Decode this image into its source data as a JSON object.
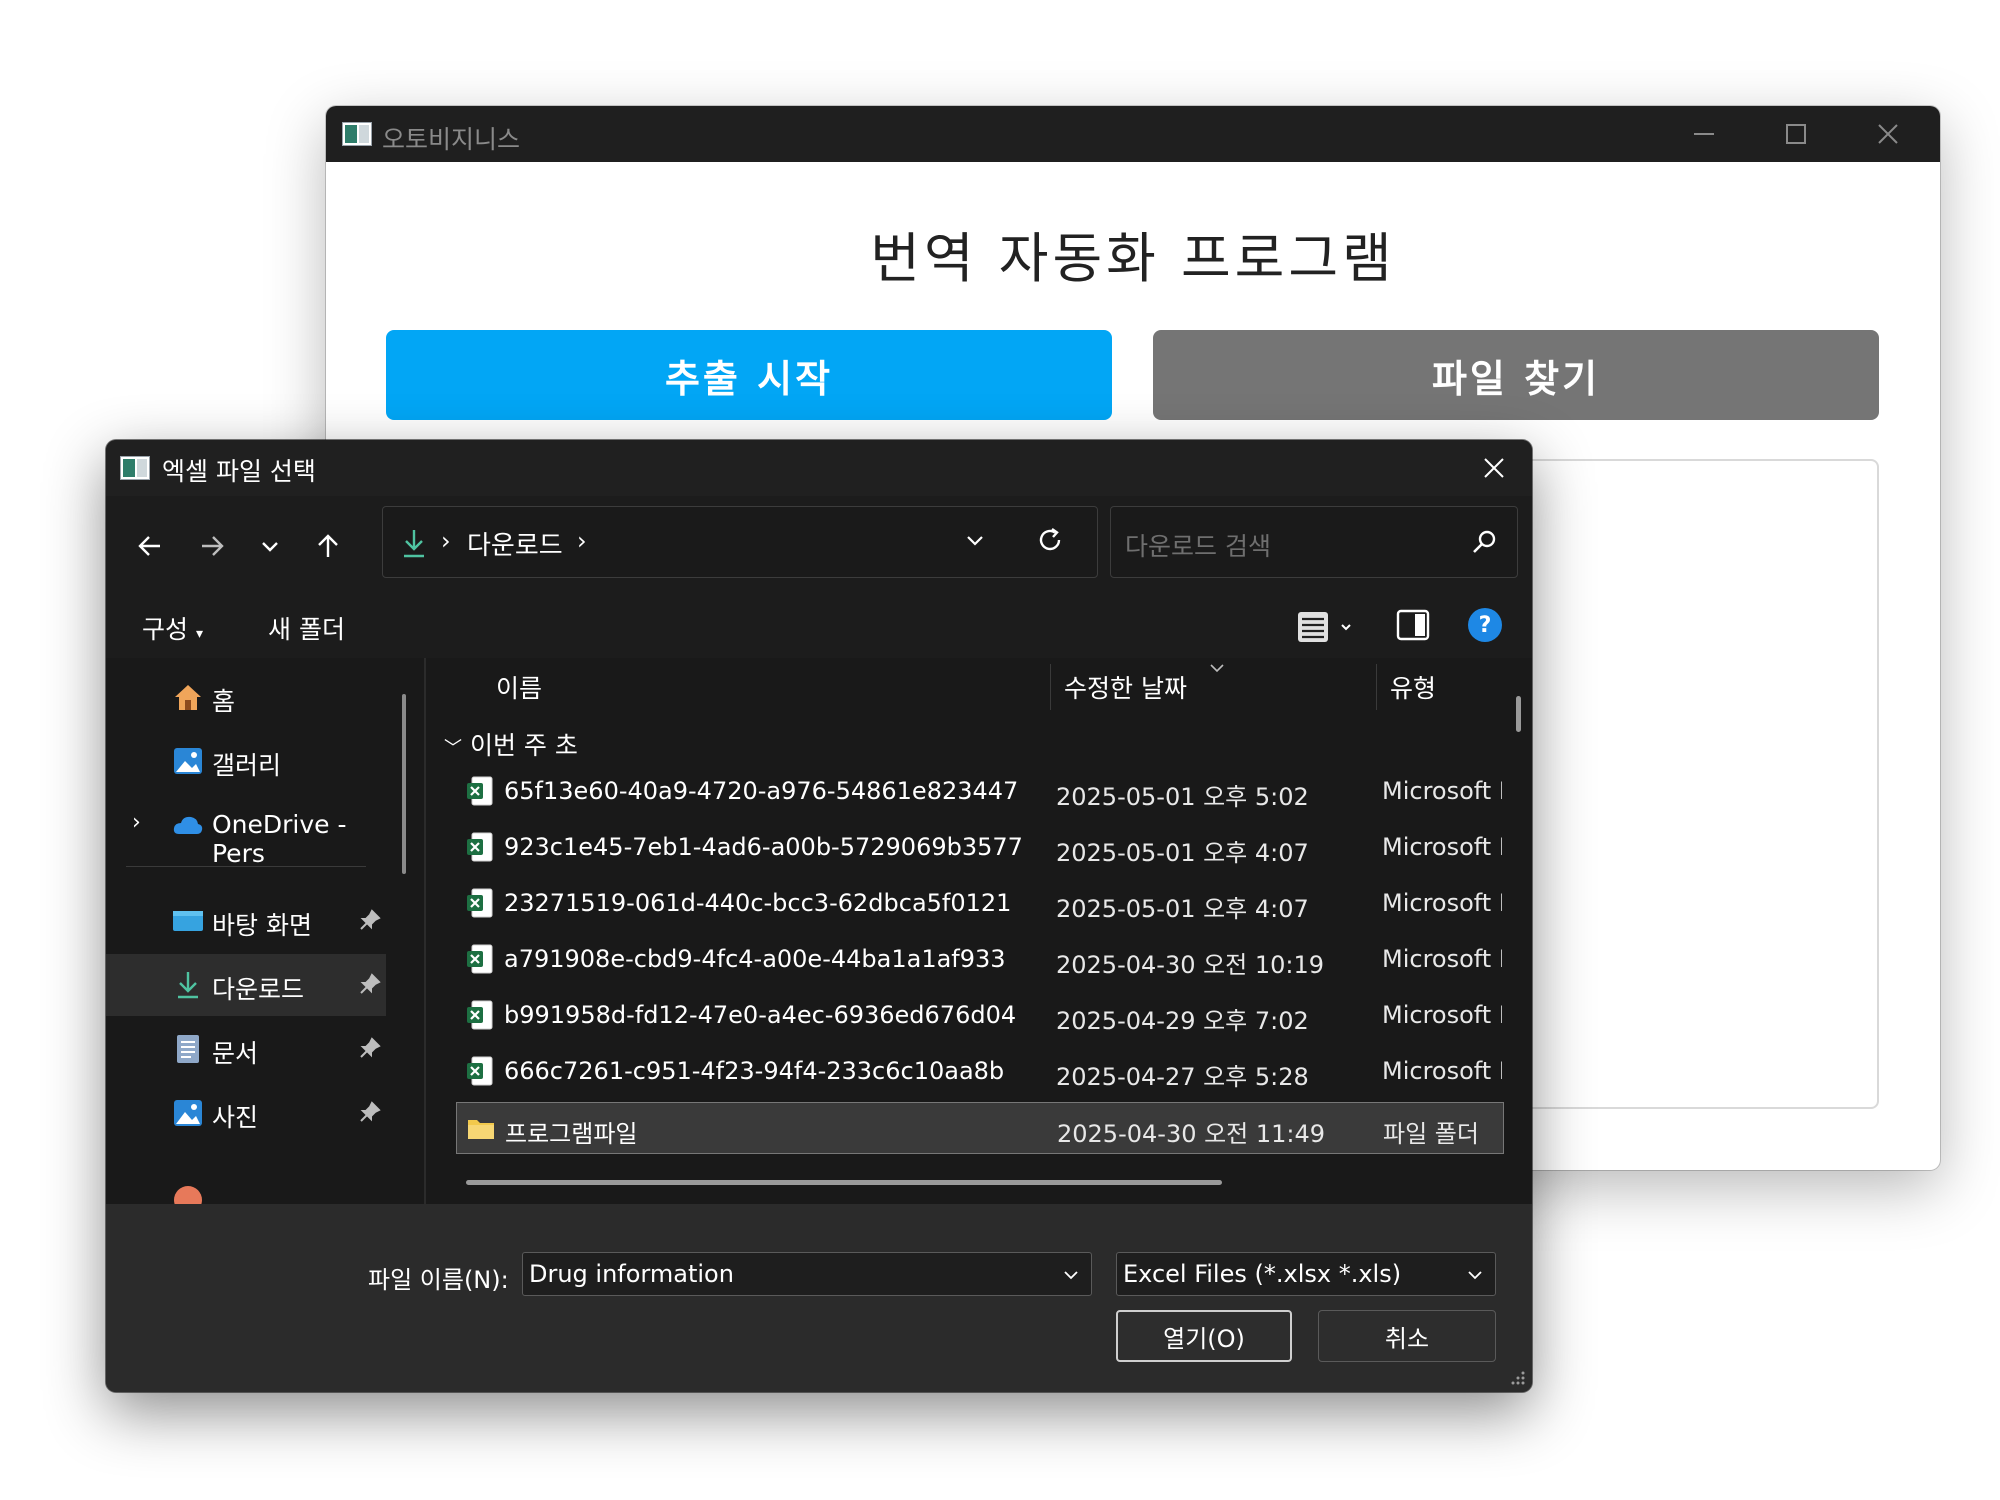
{
  "main_window": {
    "title": "오토비지니스",
    "heading": "번역 자동화 프로그램",
    "extract_button": "추출 시작",
    "find_button": "파일 찾기"
  },
  "dialog": {
    "title": "엑셀 파일 선택",
    "address": {
      "location": "다운로드"
    },
    "search": {
      "placeholder": "다운로드 검색"
    },
    "toolbar": {
      "organize": "구성",
      "new_folder": "새 폴더"
    },
    "sidebar": {
      "items": [
        {
          "label": "홈",
          "icon": "home-icon"
        },
        {
          "label": "갤러리",
          "icon": "gallery-icon"
        },
        {
          "label": "OneDrive - Pers",
          "icon": "onedrive-icon"
        },
        {
          "label": "바탕 화면",
          "icon": "desktop-icon"
        },
        {
          "label": "다운로드",
          "icon": "download-icon"
        },
        {
          "label": "문서",
          "icon": "documents-icon"
        },
        {
          "label": "사진",
          "icon": "pictures-icon"
        }
      ]
    },
    "columns": {
      "name": "이름",
      "modified": "수정한 날짜",
      "type": "유형"
    },
    "group": "이번 주 초",
    "files": [
      {
        "name": "65f13e60-40a9-4720-a976-54861e823447",
        "date": "2025-05-01 오후 5:02",
        "type": "Microsoft E"
      },
      {
        "name": "923c1e45-7eb1-4ad6-a00b-5729069b3577",
        "date": "2025-05-01 오후 4:07",
        "type": "Microsoft E"
      },
      {
        "name": "23271519-061d-440c-bcc3-62dbca5f0121",
        "date": "2025-05-01 오후 4:07",
        "type": "Microsoft E"
      },
      {
        "name": "a791908e-cbd9-4fc4-a00e-44ba1a1af933",
        "date": "2025-04-30 오전 10:19",
        "type": "Microsoft E"
      },
      {
        "name": "b991958d-fd12-47e0-a4ec-6936ed676d04",
        "date": "2025-04-29 오후 7:02",
        "type": "Microsoft E"
      },
      {
        "name": "666c7261-c951-4f23-94f4-233c6c10aa8b",
        "date": "2025-04-27 오후 5:28",
        "type": "Microsoft E"
      },
      {
        "name": "프로그램파일",
        "date": "2025-04-30 오전 11:49",
        "type": "파일 폴더"
      }
    ],
    "filename_label": "파일 이름(N):",
    "filename_value": "Drug information",
    "filetype_value": "Excel Files (*.xlsx *.xls)",
    "open_button": "열기(O)",
    "cancel_button": "취소"
  },
  "colors": {
    "accent_blue": "#02a6f5",
    "find_gray": "#757575",
    "excel_green": "#1d6f42",
    "folder_yellow": "#f2c94c"
  }
}
